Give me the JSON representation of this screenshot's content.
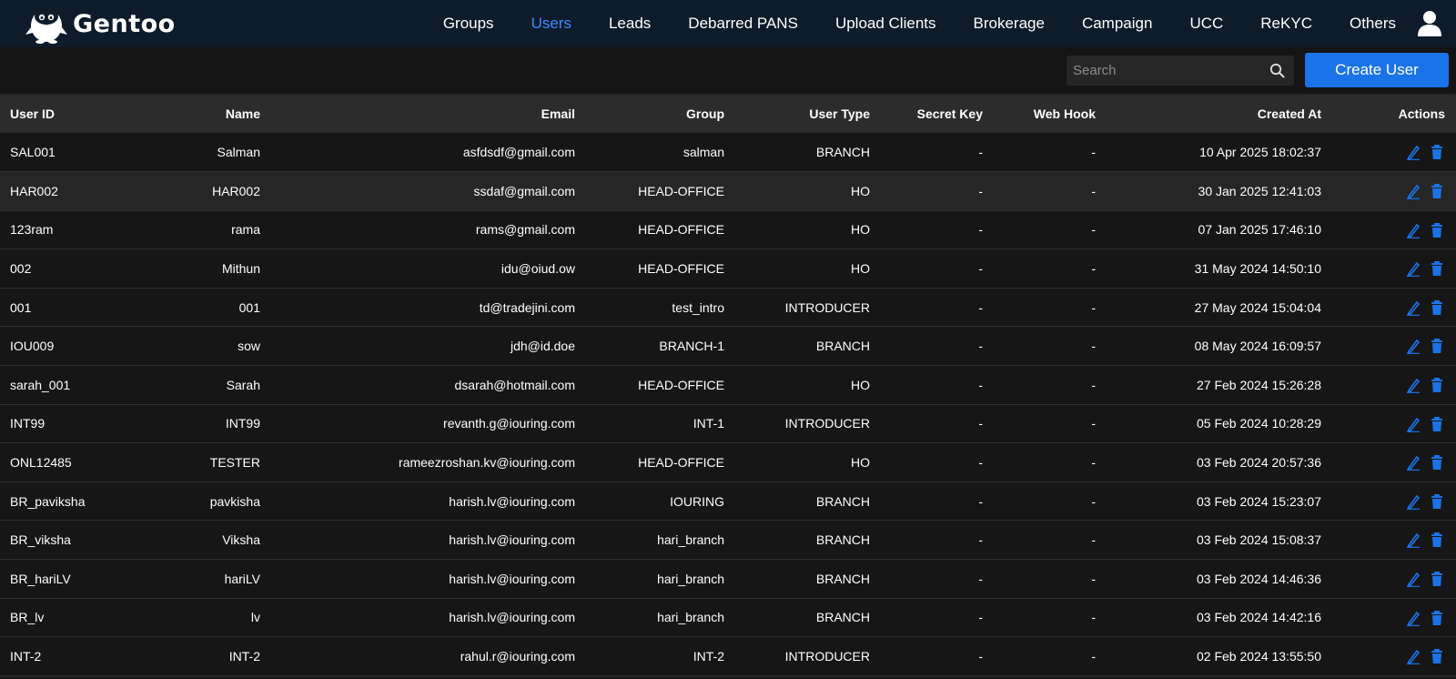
{
  "app": {
    "logo_text": "Gentoo",
    "accent_color": "#1a73e8",
    "active_nav_color": "#3d8bfd"
  },
  "nav": {
    "items": [
      {
        "label": "Groups"
      },
      {
        "label": "Users"
      },
      {
        "label": "Leads"
      },
      {
        "label": "Debarred PANS"
      },
      {
        "label": "Upload Clients"
      },
      {
        "label": "Brokerage"
      },
      {
        "label": "Campaign"
      },
      {
        "label": "UCC"
      },
      {
        "label": "ReKYC"
      },
      {
        "label": "Others"
      }
    ],
    "active": "Users",
    "user_icon": "user-icon"
  },
  "toolbar": {
    "search_placeholder": "Search",
    "search_value": "",
    "create_label": "Create User"
  },
  "table": {
    "columns": [
      "User ID",
      "Name",
      "Email",
      "Group",
      "User Type",
      "Secret Key",
      "Web Hook",
      "Created At",
      "Actions"
    ],
    "rows": [
      {
        "id": "SAL001",
        "name": "Salman",
        "email": "asfdsdf@gmail.com",
        "group": "salman",
        "type": "BRANCH",
        "secret": "-",
        "hook": "-",
        "created": "10 Apr 2025 18:02:37"
      },
      {
        "id": "HAR002",
        "name": "HAR002",
        "email": "ssdaf@gmail.com",
        "group": "HEAD-OFFICE",
        "type": "HO",
        "secret": "-",
        "hook": "-",
        "created": "30 Jan 2025 12:41:03"
      },
      {
        "id": "123ram",
        "name": "rama",
        "email": "rams@gmail.com",
        "group": "HEAD-OFFICE",
        "type": "HO",
        "secret": "-",
        "hook": "-",
        "created": "07 Jan 2025 17:46:10"
      },
      {
        "id": "002",
        "name": "Mithun",
        "email": "idu@oiud.ow",
        "group": "HEAD-OFFICE",
        "type": "HO",
        "secret": "-",
        "hook": "-",
        "created": "31 May 2024 14:50:10"
      },
      {
        "id": "001",
        "name": "001",
        "email": "td@tradejini.com",
        "group": "test_intro",
        "type": "INTRODUCER",
        "secret": "-",
        "hook": "-",
        "created": "27 May 2024 15:04:04"
      },
      {
        "id": "IOU009",
        "name": "sow",
        "email": "jdh@id.doe",
        "group": "BRANCH-1",
        "type": "BRANCH",
        "secret": "-",
        "hook": "-",
        "created": "08 May 2024 16:09:57"
      },
      {
        "id": "sarah_001",
        "name": "Sarah",
        "email": "dsarah@hotmail.com",
        "group": "HEAD-OFFICE",
        "type": "HO",
        "secret": "-",
        "hook": "-",
        "created": "27 Feb 2024 15:26:28"
      },
      {
        "id": "INT99",
        "name": "INT99",
        "email": "revanth.g@iouring.com",
        "group": "INT-1",
        "type": "INTRODUCER",
        "secret": "-",
        "hook": "-",
        "created": "05 Feb 2024 10:28:29"
      },
      {
        "id": "ONL12485",
        "name": "TESTER",
        "email": "rameezroshan.kv@iouring.com",
        "group": "HEAD-OFFICE",
        "type": "HO",
        "secret": "-",
        "hook": "-",
        "created": "03 Feb 2024 20:57:36"
      },
      {
        "id": "BR_paviksha",
        "name": "pavkisha",
        "email": "harish.lv@iouring.com",
        "group": "IOURING",
        "type": "BRANCH",
        "secret": "-",
        "hook": "-",
        "created": "03 Feb 2024 15:23:07"
      },
      {
        "id": "BR_viksha",
        "name": "Viksha",
        "email": "harish.lv@iouring.com",
        "group": "hari_branch",
        "type": "BRANCH",
        "secret": "-",
        "hook": "-",
        "created": "03 Feb 2024 15:08:37"
      },
      {
        "id": "BR_hariLV",
        "name": "hariLV",
        "email": "harish.lv@iouring.com",
        "group": "hari_branch",
        "type": "BRANCH",
        "secret": "-",
        "hook": "-",
        "created": "03 Feb 2024 14:46:36"
      },
      {
        "id": "BR_lv",
        "name": "lv",
        "email": "harish.lv@iouring.com",
        "group": "hari_branch",
        "type": "BRANCH",
        "secret": "-",
        "hook": "-",
        "created": "03 Feb 2024 14:42:16"
      },
      {
        "id": "INT-2",
        "name": "INT-2",
        "email": "rahul.r@iouring.com",
        "group": "INT-2",
        "type": "INTRODUCER",
        "secret": "-",
        "hook": "-",
        "created": "02 Feb 2024 13:55:50"
      }
    ],
    "highlighted_row": 1,
    "actions": [
      "edit-icon",
      "delete-icon"
    ],
    "action_color": "#1a73e8"
  }
}
